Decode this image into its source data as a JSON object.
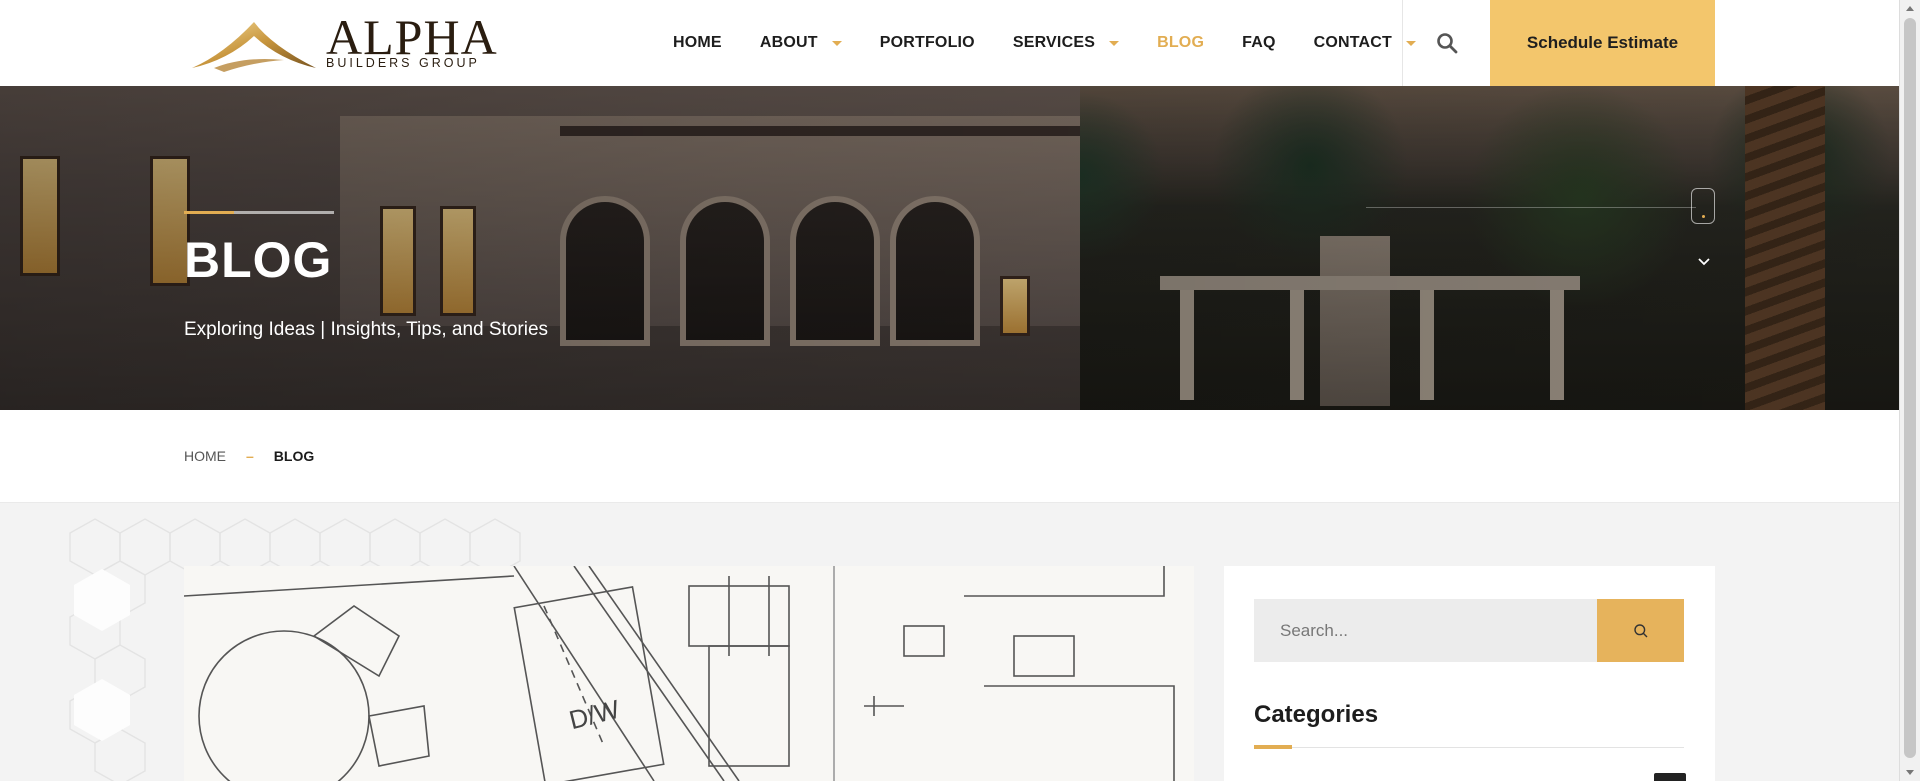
{
  "brand": {
    "name": "ALPHA",
    "tagline": "BUILDERS GROUP",
    "accent_color": "#e2ad52"
  },
  "nav": {
    "items": [
      {
        "label": "HOME",
        "dropdown": false,
        "active": false
      },
      {
        "label": "ABOUT",
        "dropdown": true,
        "active": false
      },
      {
        "label": "PORTFOLIO",
        "dropdown": false,
        "active": false
      },
      {
        "label": "SERVICES",
        "dropdown": true,
        "active": false
      },
      {
        "label": "BLOG",
        "dropdown": false,
        "active": true
      },
      {
        "label": "FAQ",
        "dropdown": false,
        "active": false
      },
      {
        "label": "CONTACT",
        "dropdown": true,
        "active": false
      }
    ],
    "search_icon": "search-icon",
    "cta_label": "Schedule Estimate",
    "cta_color": "#f3c66c"
  },
  "hero": {
    "title": "BLOG",
    "subtitle": "Exploring Ideas | Insights, Tips, and Stories"
  },
  "breadcrumb": {
    "home": "HOME",
    "separator": "–",
    "current": "BLOG"
  },
  "post": {
    "image_icon": "blueprint-floor-plan-image",
    "label_dw": "D/W"
  },
  "sidebar": {
    "search_placeholder": "Search...",
    "search_button_icon": "search-icon",
    "categories_title": "Categories"
  }
}
